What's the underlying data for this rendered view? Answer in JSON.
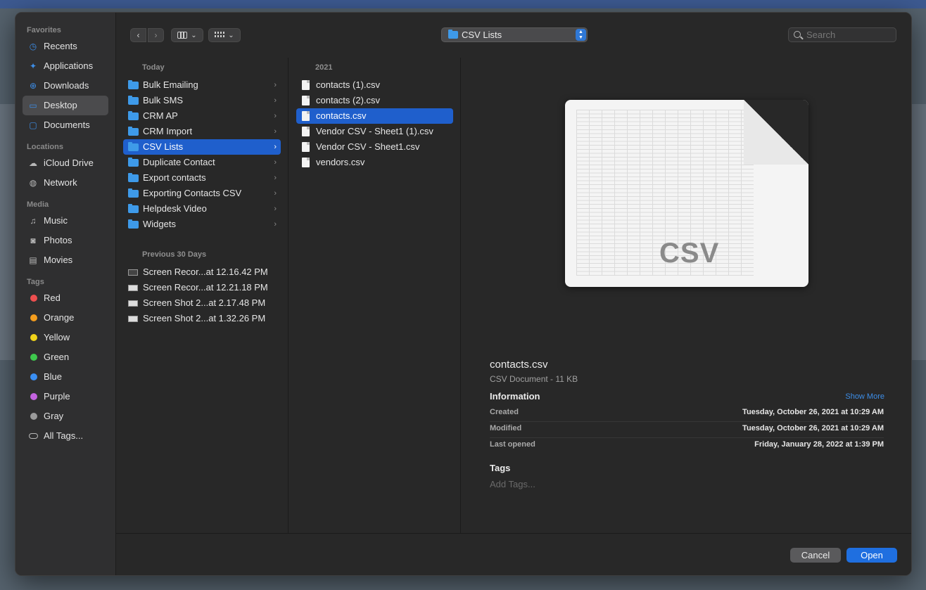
{
  "sidebar": {
    "favorites_label": "Favorites",
    "favorites": [
      {
        "label": "Recents",
        "icon": "clock-icon"
      },
      {
        "label": "Applications",
        "icon": "applications-icon"
      },
      {
        "label": "Downloads",
        "icon": "download-icon"
      },
      {
        "label": "Desktop",
        "icon": "desktop-icon",
        "selected": true
      },
      {
        "label": "Documents",
        "icon": "folder-icon"
      }
    ],
    "locations_label": "Locations",
    "locations": [
      {
        "label": "iCloud Drive",
        "icon": "cloud-icon"
      },
      {
        "label": "Network",
        "icon": "globe-icon"
      }
    ],
    "media_label": "Media",
    "media": [
      {
        "label": "Music",
        "icon": "music-note-icon"
      },
      {
        "label": "Photos",
        "icon": "camera-icon"
      },
      {
        "label": "Movies",
        "icon": "film-icon"
      }
    ],
    "tags_label": "Tags",
    "tags": [
      {
        "label": "Red",
        "color": "#ed4f4f"
      },
      {
        "label": "Orange",
        "color": "#f39d1e"
      },
      {
        "label": "Yellow",
        "color": "#f0d31a"
      },
      {
        "label": "Green",
        "color": "#3ec84d"
      },
      {
        "label": "Blue",
        "color": "#3a8ff3"
      },
      {
        "label": "Purple",
        "color": "#c463e0"
      },
      {
        "label": "Gray",
        "color": "#9a9a9a"
      }
    ],
    "all_tags": "All Tags..."
  },
  "toolbar": {
    "back": "‹",
    "forward": "›",
    "path": "CSV Lists",
    "search_placeholder": "Search"
  },
  "column1": {
    "today_header": "Today",
    "today_items": [
      {
        "label": "Bulk Emailing"
      },
      {
        "label": "Bulk SMS"
      },
      {
        "label": "CRM AP"
      },
      {
        "label": "CRM Import"
      },
      {
        "label": "CSV Lists",
        "selected": true
      },
      {
        "label": "Duplicate Contact"
      },
      {
        "label": "Export contacts"
      },
      {
        "label": "Exporting Contacts CSV"
      },
      {
        "label": "Helpdesk Video"
      },
      {
        "label": "Widgets"
      }
    ],
    "prev_header": "Previous 30 Days",
    "prev_items": [
      {
        "label": "Screen Recor...at 12.16.42 PM"
      },
      {
        "label": "Screen Recor...at 12.21.18 PM"
      },
      {
        "label": "Screen Shot 2...at 2.17.48 PM"
      },
      {
        "label": "Screen Shot 2...at 1.32.26 PM"
      }
    ]
  },
  "column2": {
    "header": "2021",
    "items": [
      {
        "label": "contacts (1).csv"
      },
      {
        "label": "contacts (2).csv"
      },
      {
        "label": "contacts.csv",
        "selected": true
      },
      {
        "label": "Vendor CSV - Sheet1 (1).csv"
      },
      {
        "label": "Vendor CSV - Sheet1.csv"
      },
      {
        "label": "vendors.csv"
      }
    ]
  },
  "preview": {
    "badge": "CSV",
    "name": "contacts.csv",
    "kind": "CSV Document - 11 KB",
    "info_title": "Information",
    "show_more": "Show More",
    "rows": [
      {
        "key": "Created",
        "value": "Tuesday, October 26, 2021 at 10:29 AM"
      },
      {
        "key": "Modified",
        "value": "Tuesday, October 26, 2021 at 10:29 AM"
      },
      {
        "key": "Last opened",
        "value": "Friday, January 28, 2022 at 1:39 PM"
      }
    ],
    "tags_title": "Tags",
    "add_tags": "Add Tags..."
  },
  "footer": {
    "cancel": "Cancel",
    "open": "Open"
  }
}
